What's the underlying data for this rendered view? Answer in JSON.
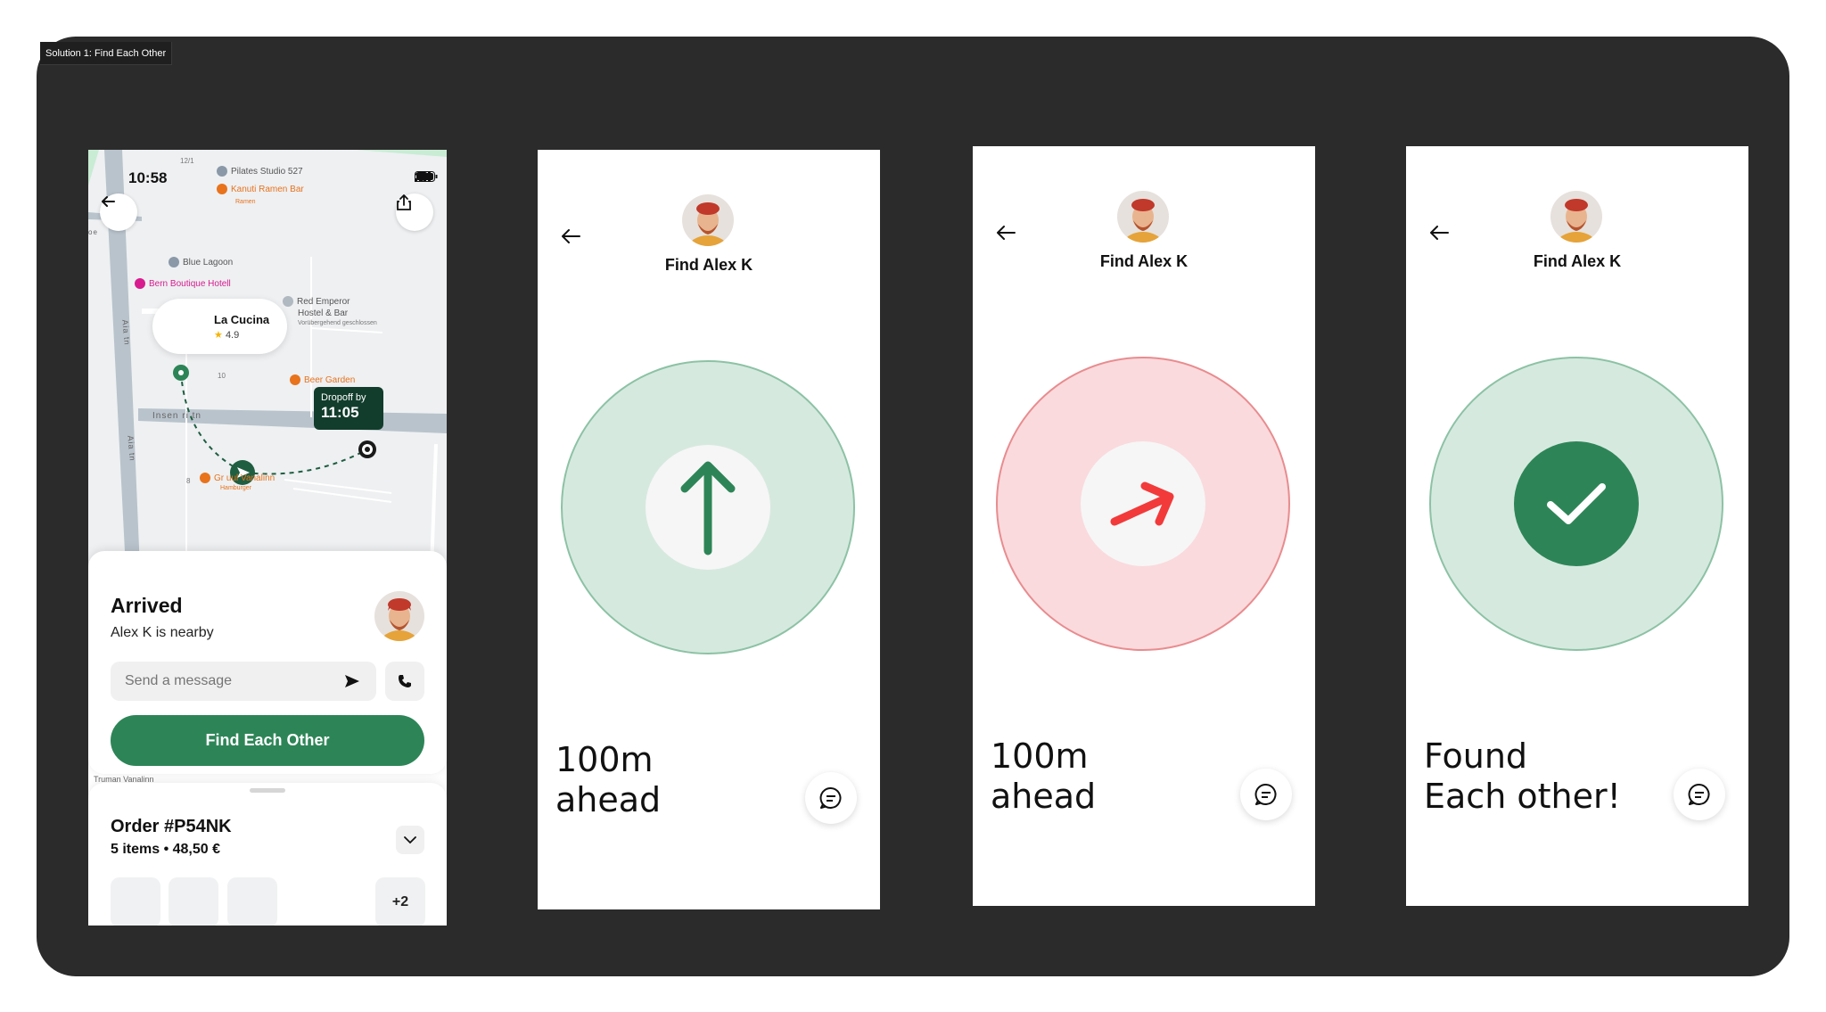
{
  "canvas": {
    "frame_label": "Solution 1: Find Each Other"
  },
  "map_screen": {
    "status_time": "10:58",
    "status_date": "12/1",
    "pois": {
      "pilates": "Pilates Studio 527",
      "kanuti": "Kanuti Ramen Bar",
      "kanuti_sub": "Ramen",
      "blue_lagoon": "Blue Lagoon",
      "bern": "Bern Boutique Hotell",
      "red_emperor": "Red Emperor",
      "red_emperor_2": "Hostel & Bar",
      "red_emperor_sub": "Vorübergehend geschlossen",
      "beer_garden": "Beer Garden",
      "hamburger_label": "Gr          uul Vanalinn",
      "hamburger_sub": "Hamburger",
      "address_num": "10",
      "address_num2": "8",
      "street_ins": "Insen  ri tn",
      "street_aia": "Aia tn",
      "street_aia2": "Aia tn",
      "street_left": "oe"
    },
    "restaurant_bubble": {
      "name": "La Cucina",
      "rating": "4.9"
    },
    "dropoff": {
      "label": "Dropoff by",
      "time": "11:05"
    },
    "sheet": {
      "title": "Arrived",
      "subtitle": "Alex K is nearby",
      "message_placeholder": "Send a message",
      "find_button": "Find Each Other",
      "peek_street": "Truman Vanalinn"
    },
    "order": {
      "title": "Order #P54NK",
      "summary": "5 items • 48,50 €",
      "more_count": "+2"
    }
  },
  "screens": [
    {
      "title": "Find Alex K",
      "distance_line1": "100m",
      "distance_line2": "ahead",
      "state": "on-track",
      "direction_icon": "arrow-up-icon"
    },
    {
      "title": "Find Alex K",
      "distance_line1": "100m",
      "distance_line2": "ahead",
      "state": "off-track",
      "direction_icon": "arrow-right-icon"
    },
    {
      "title": "Find Alex K",
      "distance_line1": "Found",
      "distance_line2": "Each other!",
      "state": "found",
      "direction_icon": "checkmark-icon"
    }
  ],
  "colors": {
    "brand_green": "#2d8557",
    "success_fill": "#d6e9df",
    "success_ring": "#8cc2a4",
    "warning_fill": "#fadadd",
    "warning_ring": "#e88c8f",
    "warning_arrow": "#f23a3a",
    "board_bg": "#2b2b2b"
  }
}
